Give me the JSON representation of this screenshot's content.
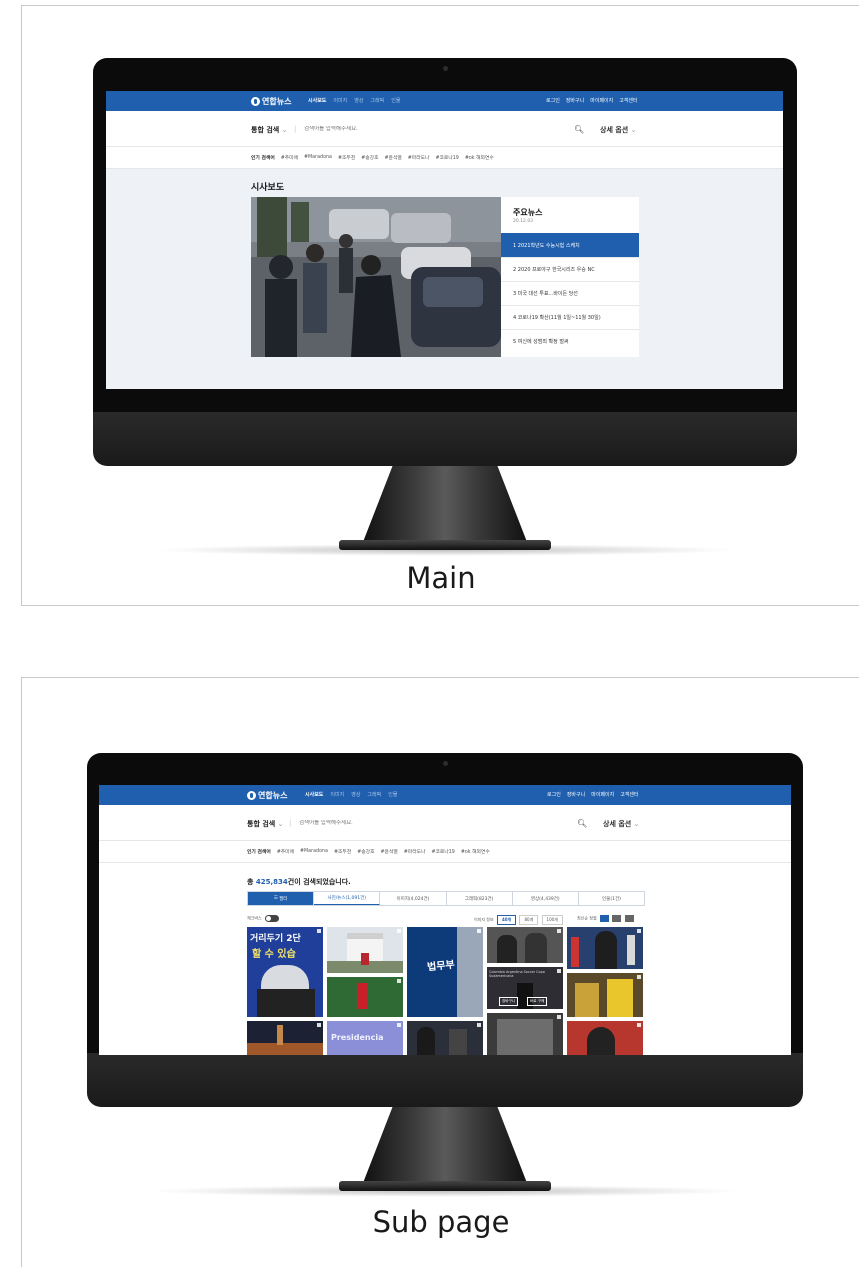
{
  "site": {
    "logo": "연합뉴스",
    "nav": [
      "시사보도",
      "이미지",
      "영상",
      "그래픽",
      "인물"
    ],
    "util": [
      "로그인",
      "장바구니",
      "마이페이지",
      "고객센터"
    ],
    "search_scope": "통합 검색",
    "search_placeholder": "검색어를 입력해주세요.",
    "advanced": "상세 옵션",
    "keywords_label": "인기 검색어",
    "keywords": [
      "#추미애",
      "#Maradona",
      "#조두천",
      "#송강호",
      "#윤석열",
      "#마라도나",
      "#코로나19",
      "#ok 해외연수"
    ]
  },
  "main_panel": {
    "caption": "Main",
    "section_title": "시사보도",
    "news_box": {
      "title": "주요뉴스",
      "date": "20.12.03",
      "items": [
        "1   2021학년도 수능시험 스케치",
        "2   2020 프로야구 한국시리즈 우승 NC",
        "3   미국 대선 투표...바이든 당선",
        "4   코로나19 확산(11월 1일~11월 30일)",
        "5   여신에 성범죄 확정 벌써"
      ]
    }
  },
  "sub_panel": {
    "caption": "Sub page",
    "result_prefix": "총 ",
    "result_count": "425,834",
    "result_suffix": "건이 검색되었습니다.",
    "tabs": [
      "필터",
      "사진/뉴스(1,091건)",
      "이미지(4,024건)",
      "그래픽(823건)",
      "영상(4,439건)",
      "인물(1건)"
    ],
    "toolbar_left": "체크박스",
    "toolbar_page_label": "이미지 정보",
    "page_sizes": [
      "40개",
      "80개",
      "100개"
    ],
    "sort_label": "최신순 정렬",
    "thumb_texts": {
      "banner_top": "거리두기 2단",
      "banner_bottom": "할 수 있습",
      "ministry": "법무부",
      "presidencia": "Presidencia",
      "caption_small": "Colombia Argentina Soccer Copa Sudamericana",
      "btn_cart": "장바구니",
      "btn_buy": "바로 구매"
    }
  }
}
